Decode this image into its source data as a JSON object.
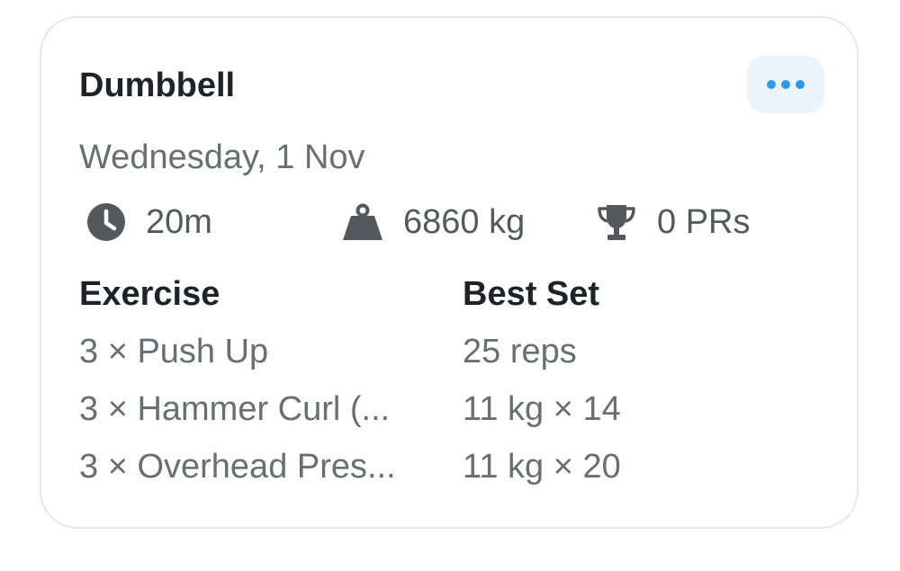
{
  "workout": {
    "title": "Dumbbell",
    "date": "Wednesday, 1 Nov",
    "menu_icon": "more-dots-icon",
    "accent_color": "#2f9be8"
  },
  "stats": {
    "duration": {
      "icon": "clock-icon",
      "value": "20m"
    },
    "volume": {
      "icon": "weight-icon",
      "value": "6860 kg"
    },
    "prs": {
      "icon": "trophy-icon",
      "value": "0 PRs"
    }
  },
  "table": {
    "headers": {
      "exercise": "Exercise",
      "best_set": "Best Set"
    },
    "rows": [
      {
        "exercise": "3 × Push Up",
        "best_set": "25 reps"
      },
      {
        "exercise": "3 × Hammer Curl (...",
        "best_set": "11 kg × 14"
      },
      {
        "exercise": "3 × Overhead Pres...",
        "best_set": "11 kg × 20"
      }
    ]
  }
}
